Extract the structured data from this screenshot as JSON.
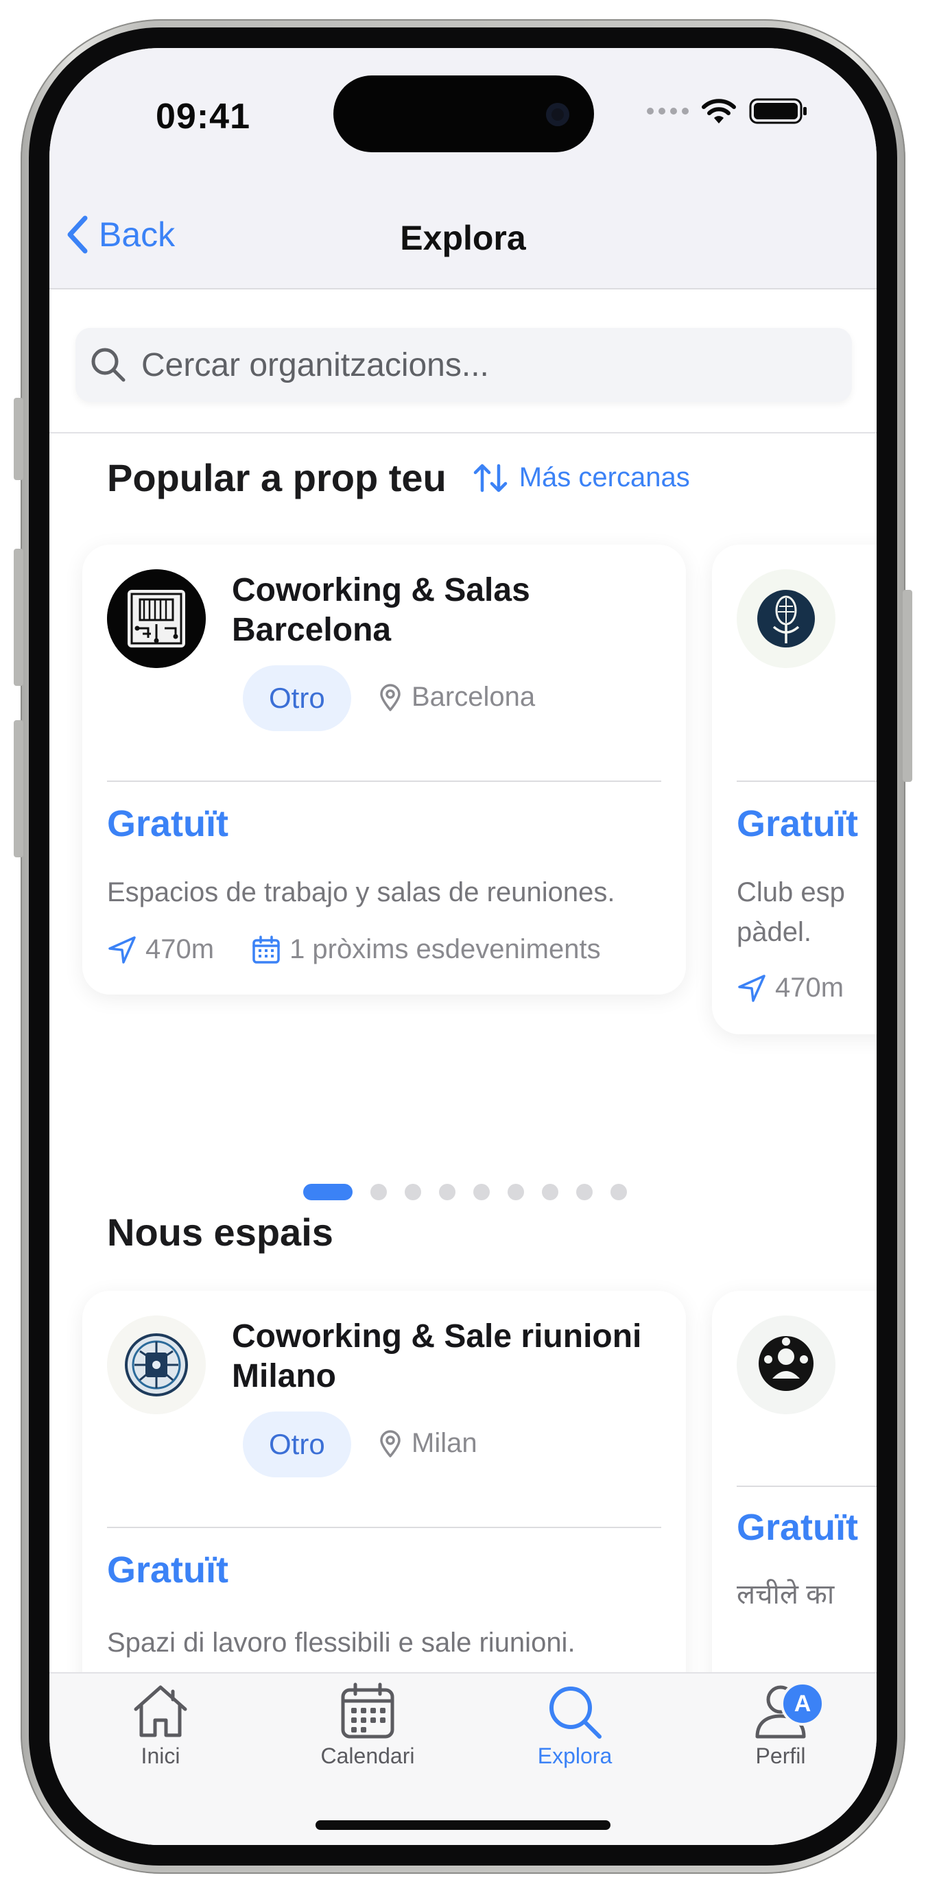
{
  "status_bar": {
    "time": "09:41"
  },
  "nav": {
    "back_label": "Back",
    "title": "Explora"
  },
  "search": {
    "placeholder": "Cercar organitzacions..."
  },
  "popular": {
    "title": "Popular a prop teu",
    "sort_label": "Más cercanas",
    "cards": [
      {
        "name": "Coworking & Salas Barcelona",
        "tag": "Otro",
        "location": "Barcelona",
        "price": "Gratuït",
        "description": "Espacios de trabajo y salas de reuniones.",
        "distance": "470m",
        "events": "1 pròxims esdeveniments"
      },
      {
        "price": "Gratuït",
        "description": "Club esp\npàdel.",
        "distance": "470m"
      }
    ],
    "page_count": 9,
    "active_page": 1
  },
  "new_spaces": {
    "title": "Nous espais",
    "cards": [
      {
        "name": "Coworking & Sale riunioni Milano",
        "tag": "Otro",
        "location": "Milan",
        "price": "Gratuït",
        "description": "Spazi di lavoro flessibili e sale riunioni."
      },
      {
        "price": "Gratuït",
        "description": "लचीले का"
      }
    ]
  },
  "tab_bar": {
    "tabs": [
      {
        "label": "Inici",
        "icon": "home-icon"
      },
      {
        "label": "Calendari",
        "icon": "calendar-icon"
      },
      {
        "label": "Explora",
        "icon": "search-icon",
        "active": true
      },
      {
        "label": "Perfil",
        "icon": "profile-icon",
        "badge": "A"
      }
    ]
  },
  "colors": {
    "accent": "#3b82f6",
    "tag_bg": "#e9f1fe",
    "nav_bg": "#f2f2f7",
    "text": "#1b1b1d",
    "muted": "#8a8a8f"
  }
}
